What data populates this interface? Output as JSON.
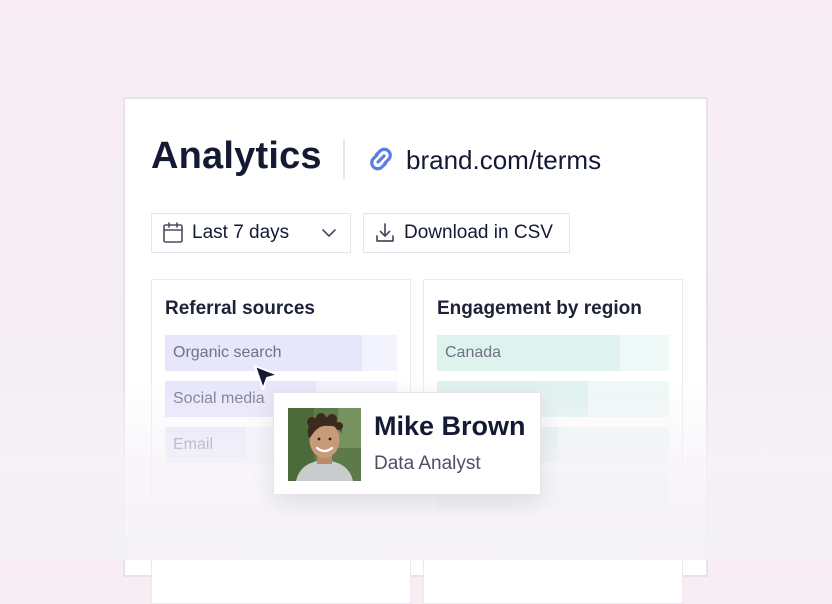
{
  "header": {
    "title": "Analytics",
    "url": "brand.com/terms",
    "link_icon": "link-icon"
  },
  "toolbar": {
    "date_range": {
      "value": "Last 7 days",
      "icon": "calendar-icon",
      "chevron": "chevron-down-icon"
    },
    "download": {
      "label": "Download in CSV",
      "icon": "download-icon"
    }
  },
  "referral": {
    "title": "Referral sources",
    "color": "#e7e6fb",
    "track_color": "#f3f3fd",
    "items": [
      {
        "label": "Organic search",
        "fraction": 0.85
      },
      {
        "label": "Social media",
        "fraction": 0.65
      },
      {
        "label": "Email",
        "fraction": 0.35
      }
    ]
  },
  "engagement": {
    "title": "Engagement by region",
    "color": "#def2ee",
    "track_color": "#eff9f7",
    "items": [
      {
        "label": "Canada",
        "fraction": 0.79
      },
      {
        "label": "",
        "fraction": 0.65
      },
      {
        "label": "",
        "fraction": 0.52
      },
      {
        "label": "",
        "fraction": 0.32
      }
    ]
  },
  "tooltip": {
    "name": "Mike Brown",
    "role": "Data Analyst"
  },
  "colors": {
    "text_primary": "#141a33",
    "link_icon": "#5b7de8"
  }
}
